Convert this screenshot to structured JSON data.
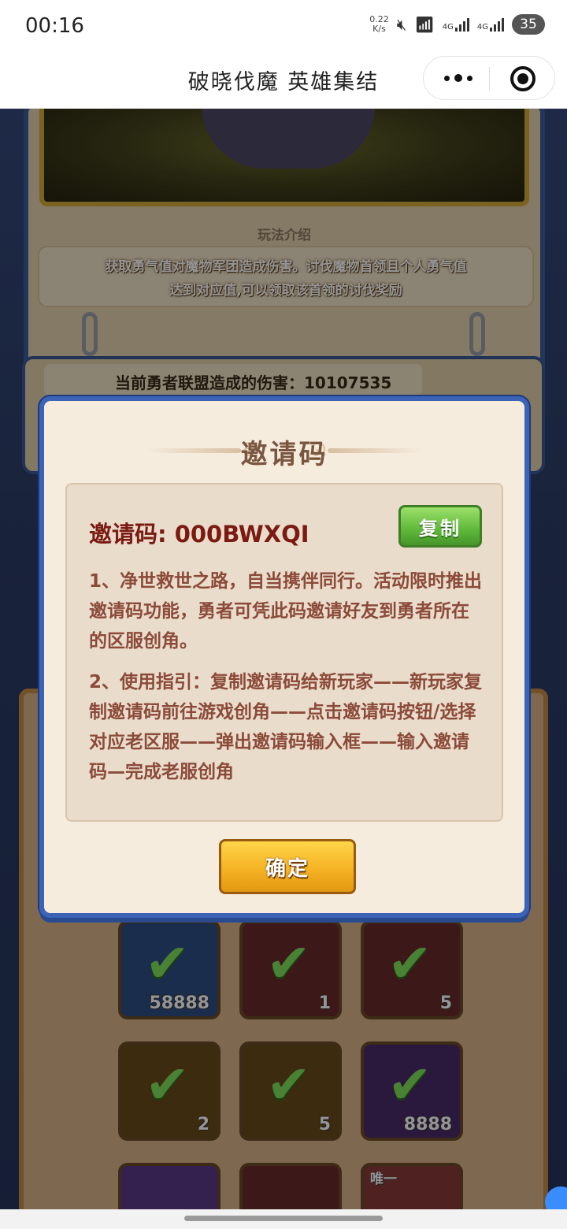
{
  "status_bar": {
    "time": "00:16",
    "net_speed_value": "0.22",
    "net_speed_unit": "K/s",
    "sim1": "4G",
    "sim2": "4G",
    "battery": "35"
  },
  "title_bar": {
    "title": "破晓伐魔 英雄集结"
  },
  "background": {
    "howto_label": "玩法介绍",
    "howto_line1": "获取勇气值对魔物军团造成伤害。讨伐魔物首领且个人勇气值",
    "howto_line2": "达到对应值,可以领取该首领的讨伐奖励",
    "damage_text": "当前勇者联盟造成的伤害：10107535",
    "tiles": [
      {
        "count": "58888",
        "tag": ""
      },
      {
        "count": "1",
        "tag": ""
      },
      {
        "count": "5",
        "tag": ""
      },
      {
        "count": "2",
        "tag": ""
      },
      {
        "count": "5",
        "tag": ""
      },
      {
        "count": "8888",
        "tag": ""
      },
      {
        "count": "",
        "tag": ""
      },
      {
        "count": "",
        "tag": ""
      },
      {
        "count": "",
        "tag": "唯一"
      }
    ]
  },
  "modal": {
    "title": "邀请码",
    "code_label": "邀请码: ",
    "code_value": "000BWXQI",
    "copy_label": "复制",
    "para1": "1、净世救世之路，自当携伴同行。活动限时推出邀请码功能，勇者可凭此码邀请好友到勇者所在的区服创角。",
    "para2": "2、使用指引：复制邀请码给新玩家——新玩家复制邀请码前往游戏创角——点击邀请码按钮/选择对应老区服——弹出邀请码输入框——输入邀请码—完成老服创角",
    "confirm_label": "确定"
  }
}
